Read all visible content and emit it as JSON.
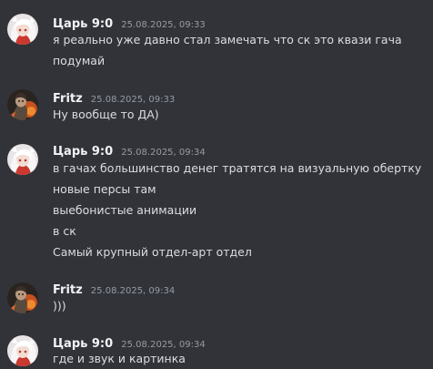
{
  "messages": [
    {
      "author": "Царь 9:0",
      "timestamp": "25.08.2025, 09:33",
      "avatar": "white-haired-anime-avatar",
      "lines": [
        "я реально уже давно стал замечать что ск это квази гача",
        "подумай"
      ]
    },
    {
      "author": "Fritz",
      "timestamp": "25.08.2025, 09:33",
      "avatar": "dark-fire-character-avatar",
      "lines": [
        "Ну вообще то ДА)"
      ]
    },
    {
      "author": "Царь 9:0",
      "timestamp": "25.08.2025, 09:34",
      "avatar": "white-haired-anime-avatar",
      "lines": [
        "в гачах большинство денег тратятся на визуальную обертку",
        "новые персы там",
        "выебонистые анимации",
        "в ск",
        "Самый крупный отдел-арт отдел"
      ]
    },
    {
      "author": "Fritz",
      "timestamp": "25.08.2025, 09:34",
      "avatar": "dark-fire-character-avatar",
      "lines": [
        ")))"
      ]
    },
    {
      "author": "Царь 9:0",
      "timestamp": "25.08.2025, 09:34",
      "avatar": "white-haired-anime-avatar",
      "lines": [
        "где и звук и картинка"
      ]
    }
  ]
}
